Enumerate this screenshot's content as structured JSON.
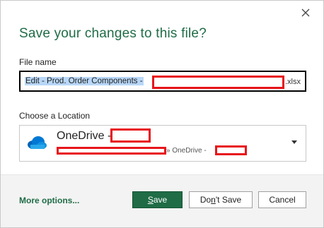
{
  "dialog": {
    "title": "Save your changes to this file?",
    "close_icon": "close-icon"
  },
  "filename": {
    "label": "File name",
    "value": "Edit - Prod. Order Components -",
    "extension": ".xlsx"
  },
  "location": {
    "label": "Choose a Location",
    "name": "OneDrive -",
    "path_suffix": "» OneDrive -",
    "icon": "onedrive-cloud-icon"
  },
  "footer": {
    "more_options": "More options...",
    "save_mnemonic": "S",
    "save_rest": "ave",
    "dontsave_pre": "Do",
    "dontsave_mnemonic": "n",
    "dontsave_rest": "'t Save",
    "cancel": "Cancel"
  },
  "colors": {
    "accent": "#1f6c46",
    "redaction": "#e8151b",
    "selection": "#b8d7f8"
  }
}
